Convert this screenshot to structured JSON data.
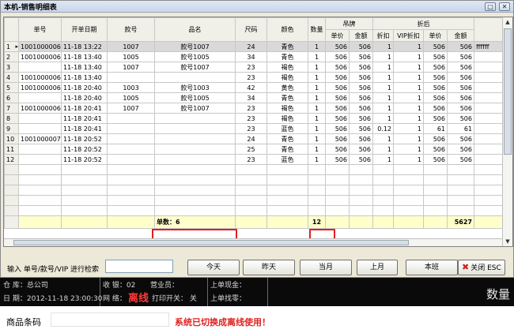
{
  "window": {
    "title": "本机-销售明细表",
    "restore_icon": "□",
    "close_icon": "✕"
  },
  "grid": {
    "group_headers": {
      "tag_price": "吊牌",
      "discounted": "折后"
    },
    "headers": {
      "order_no": "单号",
      "date": "开单日期",
      "style_no": "款号",
      "name": "品名",
      "size": "尺码",
      "color": "颜色",
      "qty": "数量",
      "tag_unit_price": "单价",
      "tag_amount": "金额",
      "discount": "折扣",
      "vip_discount": "VIP折扣",
      "unit_price": "单价",
      "amount": "金额"
    },
    "rows": [
      {
        "n": "1",
        "marker": "▸",
        "order": "10010000065",
        "date": "11-18 13:22",
        "style": "1007",
        "name": "款号1007",
        "size": "24",
        "color": "青色",
        "qty": "1",
        "tp": "506",
        "ta": "506",
        "disc": "1",
        "vip": "1",
        "up": "506",
        "amt": "506",
        "extra": "ffffff"
      },
      {
        "n": "2",
        "marker": "",
        "order": "10010000066",
        "date": "11-18 13:40",
        "style": "1005",
        "name": "款号1005",
        "size": "34",
        "color": "青色",
        "qty": "1",
        "tp": "506",
        "ta": "506",
        "disc": "1",
        "vip": "1",
        "up": "506",
        "amt": "506",
        "extra": ""
      },
      {
        "n": "3",
        "marker": "",
        "order": "",
        "date": "11-18 13:40",
        "style": "1007",
        "name": "款号1007",
        "size": "23",
        "color": "褐色",
        "qty": "1",
        "tp": "506",
        "ta": "506",
        "disc": "1",
        "vip": "1",
        "up": "506",
        "amt": "506",
        "extra": ""
      },
      {
        "n": "4",
        "marker": "",
        "order": "10010000067",
        "date": "11-18 13:40",
        "style": "",
        "name": "",
        "size": "23",
        "color": "褐色",
        "qty": "1",
        "tp": "506",
        "ta": "506",
        "disc": "1",
        "vip": "1",
        "up": "506",
        "amt": "506",
        "extra": ""
      },
      {
        "n": "5",
        "marker": "",
        "order": "10010000068",
        "date": "11-18 20:40",
        "style": "1003",
        "name": "款号1003",
        "size": "42",
        "color": "黄色",
        "qty": "1",
        "tp": "506",
        "ta": "506",
        "disc": "1",
        "vip": "1",
        "up": "506",
        "amt": "506",
        "extra": ""
      },
      {
        "n": "6",
        "marker": "",
        "order": "",
        "date": "11-18 20:40",
        "style": "1005",
        "name": "款号1005",
        "size": "34",
        "color": "青色",
        "qty": "1",
        "tp": "506",
        "ta": "506",
        "disc": "1",
        "vip": "1",
        "up": "506",
        "amt": "506",
        "extra": ""
      },
      {
        "n": "7",
        "marker": "",
        "order": "10010000069",
        "date": "11-18 20:41",
        "style": "1007",
        "name": "款号1007",
        "size": "23",
        "color": "褐色",
        "qty": "1",
        "tp": "506",
        "ta": "506",
        "disc": "1",
        "vip": "1",
        "up": "506",
        "amt": "506",
        "extra": ""
      },
      {
        "n": "8",
        "marker": "",
        "order": "",
        "date": "11-18 20:41",
        "style": "",
        "name": "",
        "size": "23",
        "color": "褐色",
        "qty": "1",
        "tp": "506",
        "ta": "506",
        "disc": "1",
        "vip": "1",
        "up": "506",
        "amt": "506",
        "extra": ""
      },
      {
        "n": "9",
        "marker": "",
        "order": "",
        "date": "11-18 20:41",
        "style": "",
        "name": "",
        "size": "23",
        "color": "蓝色",
        "qty": "1",
        "tp": "506",
        "ta": "506",
        "disc": "0.12",
        "vip": "1",
        "up": "61",
        "amt": "61",
        "extra": ""
      },
      {
        "n": "10",
        "marker": "",
        "order": "10010000070",
        "date": "11-18 20:52",
        "style": "",
        "name": "",
        "size": "24",
        "color": "青色",
        "qty": "1",
        "tp": "506",
        "ta": "506",
        "disc": "1",
        "vip": "1",
        "up": "506",
        "amt": "506",
        "extra": ""
      },
      {
        "n": "11",
        "marker": "",
        "order": "",
        "date": "11-18 20:52",
        "style": "",
        "name": "",
        "size": "25",
        "color": "青色",
        "qty": "1",
        "tp": "506",
        "ta": "506",
        "disc": "1",
        "vip": "1",
        "up": "506",
        "amt": "506",
        "extra": ""
      },
      {
        "n": "12",
        "marker": "",
        "order": "",
        "date": "11-18 20:52",
        "style": "",
        "name": "",
        "size": "23",
        "color": "蓝色",
        "qty": "1",
        "tp": "506",
        "ta": "506",
        "disc": "1",
        "vip": "1",
        "up": "506",
        "amt": "506",
        "extra": ""
      }
    ],
    "summary": {
      "count_label": "单数：6",
      "qty_total": "12",
      "amount_total": "5627"
    }
  },
  "toolbar": {
    "search_label": "输入 单号/款号/VIP 进行检索",
    "search_value": "",
    "buttons": {
      "today": "今天",
      "yesterday": "昨天",
      "this_month": "当月",
      "last_month": "上月",
      "this_shift": "本班"
    },
    "close_label": "关闭 ESC",
    "close_icon": "✖"
  },
  "status_bar": {
    "row1": {
      "a": "仓  库：总公司",
      "b": "收  银：02",
      "c": "营业员：",
      "d": "上单现金："
    },
    "row2": {
      "date": "日  期：2012-11-18 23:00:30",
      "net_label": "网  络：",
      "net_status": "离线",
      "print": "打印开关：  关",
      "change": "上单找零："
    },
    "qty_label": "数量"
  },
  "bottom": {
    "barcode_label": "商品条码",
    "message": "系统已切换成离线使用！"
  },
  "colors": {
    "accent_red": "#e02020",
    "offline_red": "#ff3b3b",
    "summary_bg": "#ffffcc",
    "status_bg": "#0a0a0a"
  }
}
